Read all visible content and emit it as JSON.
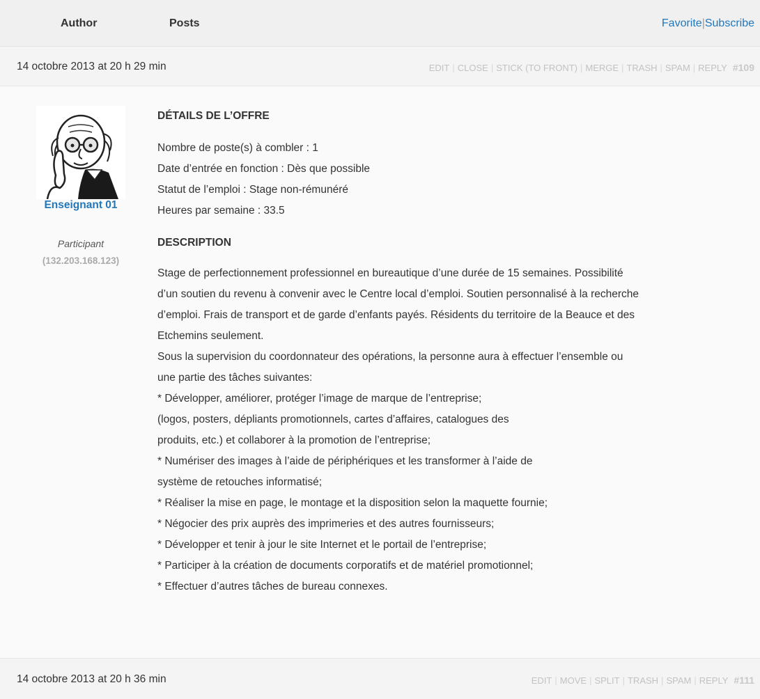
{
  "header": {
    "author_col": "Author",
    "posts_col": "Posts",
    "favorite": "Favorite",
    "separator": "|",
    "subscribe": "Subscribe"
  },
  "post1": {
    "date": "14 octobre 2013 at 20 h 29 min",
    "admin_links": [
      "EDIT",
      "CLOSE",
      "STICK (TO FRONT)",
      "MERGE",
      "TRASH",
      "SPAM",
      "REPLY"
    ],
    "post_id": "#109",
    "author": {
      "avatar_icon": "cartoon-teacher-avatar",
      "name": "Enseignant 01",
      "role": "Participant",
      "ip": "(132.203.168.123)"
    },
    "details_heading": "DÉTAILS DE L’OFFRE",
    "details": [
      "Nombre de poste(s) à combler : 1",
      "Date d’entrée en fonction : Dès que possible",
      "Statut de l’emploi : Stage non-rémunéré",
      "Heures par semaine : 33.5"
    ],
    "description_heading": "DESCRIPTION",
    "description": [
      "Stage de perfectionnement professionnel en bureautique d’une durée de 15 semaines. Possibilité",
      "d’un soutien du revenu à convenir avec le Centre local d’emploi. Soutien personnalisé à la recherche",
      "d’emploi. Frais de transport et de garde d’enfants payés. Résidents du territoire de la Beauce et des",
      "Etchemins seulement.",
      "Sous la supervision du coordonnateur des opérations, la personne aura à effectuer l’ensemble ou",
      "une partie des tâches suivantes:",
      "* Développer, améliorer, protéger l’image de marque de l’entreprise;",
      "(logos, posters, dépliants promotionnels, cartes d’affaires, catalogues des",
      "produits, etc.) et collaborer à la promotion de l’entreprise;",
      "* Numériser des images à l’aide de périphériques et les transformer à l’aide de",
      "système de retouches informatisé;",
      "* Réaliser la mise en page, le montage et la disposition selon la maquette fournie;",
      "* Négocier des prix auprès des imprimeries et des autres fournisseurs;",
      "* Développer et tenir à jour le site Internet et le portail de l’entreprise;",
      "* Participer à la création de documents corporatifs et de matériel promotionnel;",
      "* Effectuer d’autres tâches de bureau connexes."
    ]
  },
  "post2": {
    "date": "14 octobre 2013 at 20 h 36 min",
    "admin_links": [
      "EDIT",
      "MOVE",
      "SPLIT",
      "TRASH",
      "SPAM",
      "REPLY"
    ],
    "post_id": "#111"
  }
}
